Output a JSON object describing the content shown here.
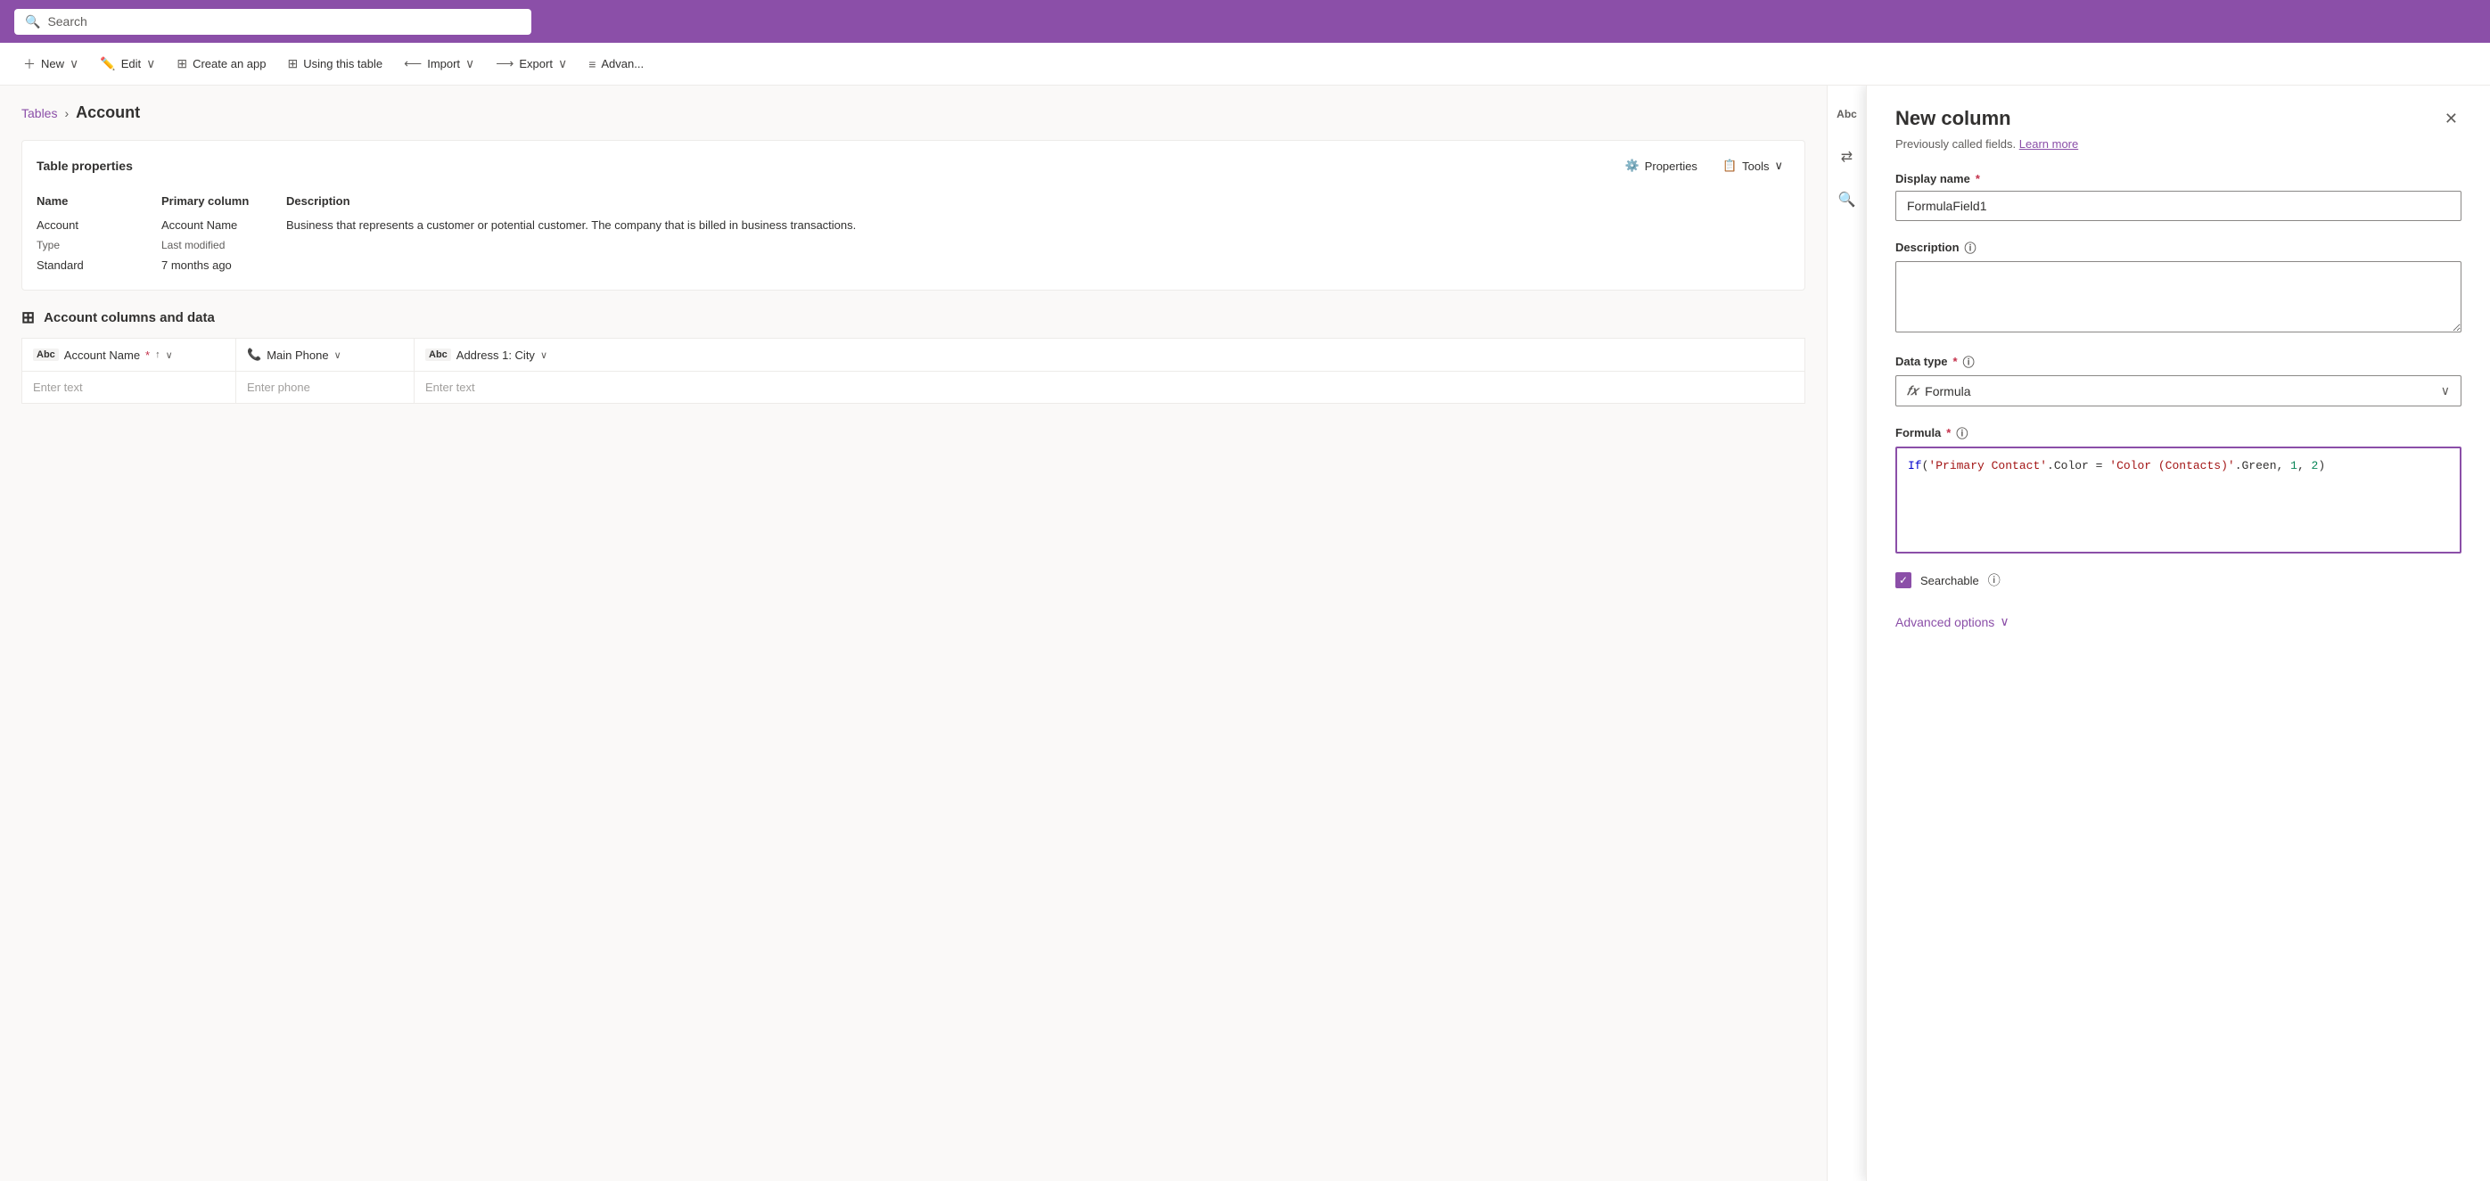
{
  "topbar": {
    "search_placeholder": "Search"
  },
  "toolbar": {
    "new_label": "New",
    "edit_label": "Edit",
    "create_app_label": "Create an app",
    "using_table_label": "Using this table",
    "import_label": "Import",
    "export_label": "Export",
    "advanced_label": "Advan..."
  },
  "breadcrumb": {
    "parent": "Tables",
    "current": "Account"
  },
  "table_properties": {
    "card_title": "Table properties",
    "properties_btn": "Properties",
    "tools_btn": "Tools",
    "headers": [
      "Name",
      "Primary column",
      "Description"
    ],
    "rows": [
      [
        "Account",
        "Account Name",
        "Business that represents a customer or potential customer. The company that is billed in business transactions."
      ],
      [
        "Type",
        "Last modified",
        ""
      ],
      [
        "Standard",
        "7 months ago",
        ""
      ]
    ]
  },
  "account_columns": {
    "section_title": "Account columns and data",
    "columns": [
      {
        "icon": "Abc",
        "label": "Account Name",
        "required": true,
        "sortable": true,
        "has_chevron": true
      },
      {
        "icon": "phone",
        "label": "Main Phone",
        "required": false,
        "sortable": false,
        "has_chevron": true
      },
      {
        "icon": "Abc",
        "label": "Address 1: City",
        "required": false,
        "sortable": false,
        "has_chevron": true
      }
    ],
    "row_placeholders": [
      "Enter text",
      "Enter phone",
      "Enter text"
    ]
  },
  "new_column_panel": {
    "title": "New column",
    "subtitle": "Previously called fields.",
    "learn_more": "Learn more",
    "display_name_label": "Display name",
    "display_name_required": true,
    "display_name_value": "FormulaField1",
    "description_label": "Description",
    "description_info": true,
    "description_value": "",
    "data_type_label": "Data type",
    "data_type_required": true,
    "data_type_info": true,
    "data_type_value": "Formula",
    "formula_label": "Formula",
    "formula_required": true,
    "formula_info": true,
    "formula_value": "If('Primary Contact'.Color = 'Color (Contacts)'.Green, 1, 2)",
    "searchable_label": "Searchable",
    "searchable_info": true,
    "searchable_checked": true,
    "advanced_options_label": "Advanced options"
  }
}
